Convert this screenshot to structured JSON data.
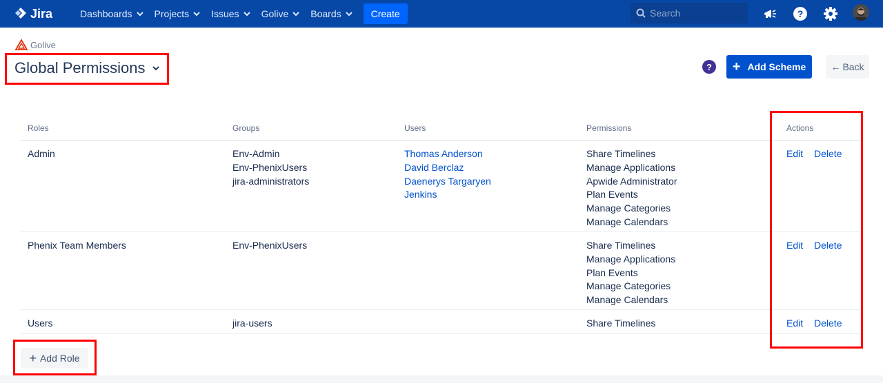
{
  "nav": {
    "logo_text": "Jira",
    "items": [
      {
        "label": "Dashboards"
      },
      {
        "label": "Projects"
      },
      {
        "label": "Issues"
      },
      {
        "label": "Golive"
      },
      {
        "label": "Boards"
      }
    ],
    "create_label": "Create",
    "search_placeholder": "Search",
    "bg_color": "#0747a6"
  },
  "header": {
    "project_name": "Golive",
    "page_title": "Global Permissions",
    "help_glyph": "?",
    "add_scheme_label": "Add Scheme",
    "back_label": "Back"
  },
  "table": {
    "headers": {
      "roles": "Roles",
      "groups": "Groups",
      "users": "Users",
      "permissions": "Permissions",
      "actions": "Actions"
    },
    "rows": [
      {
        "role": "Admin",
        "groups": [
          "Env-Admin",
          "Env-PhenixUsers",
          "jira-administrators"
        ],
        "users": [
          "Thomas Anderson",
          "David Berclaz",
          "Daenerys Targaryen",
          "Jenkins"
        ],
        "permissions": [
          "Share Timelines",
          "Manage Applications",
          "Apwide Administrator",
          "Plan Events",
          "Manage Categories",
          "Manage Calendars"
        ],
        "edit": "Edit",
        "delete": "Delete"
      },
      {
        "role": "Phenix Team Members",
        "groups": [
          "Env-PhenixUsers"
        ],
        "users": [],
        "permissions": [
          "Share Timelines",
          "Manage Applications",
          "Plan Events",
          "Manage Categories",
          "Manage Calendars"
        ],
        "edit": "Edit",
        "delete": "Delete"
      },
      {
        "role": "Users",
        "groups": [
          "jira-users"
        ],
        "users": [],
        "permissions": [
          "Share Timelines"
        ],
        "edit": "Edit",
        "delete": "Delete"
      }
    ]
  },
  "add_role_label": "Add Role",
  "colors": {
    "primary": "#0052cc",
    "link": "#0052cc",
    "highlight": "#ff0000"
  }
}
